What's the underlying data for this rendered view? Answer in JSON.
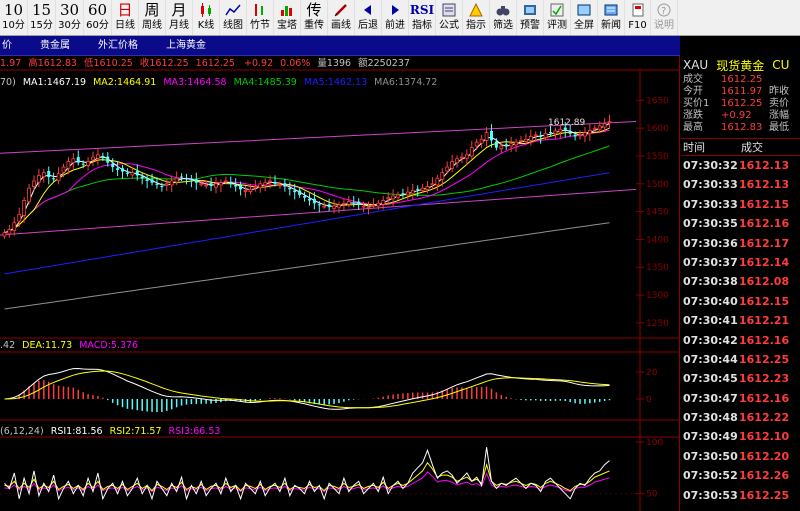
{
  "toolbar": [
    {
      "big": "10",
      "label": "10分"
    },
    {
      "big": "15",
      "label": "15分"
    },
    {
      "big": "30",
      "label": "30分"
    },
    {
      "big": "60",
      "label": "60分"
    },
    {
      "big": "日",
      "label": "日线"
    },
    {
      "big": "周",
      "label": "周线"
    },
    {
      "big": "月",
      "label": "月线"
    },
    {
      "icon": "candlestick-icon",
      "label": "K线"
    },
    {
      "icon": "line-chart-icon",
      "label": "线图"
    },
    {
      "icon": "bamboo-line-icon",
      "label": "竹节"
    },
    {
      "icon": "tower-line-icon",
      "label": "宝塔"
    },
    {
      "big": "传",
      "label": "重传"
    },
    {
      "icon": "pencil-icon",
      "label": "画线"
    },
    {
      "icon": "arrow-left-icon",
      "label": "后退"
    },
    {
      "icon": "arrow-right-icon",
      "label": "前进"
    },
    {
      "big": "RSI",
      "label": "指标"
    },
    {
      "icon": "formula-icon",
      "label": "公式"
    },
    {
      "icon": "signal-icon",
      "label": "指示"
    },
    {
      "icon": "binoculars-icon",
      "label": "筛选"
    },
    {
      "icon": "alert-icon",
      "label": "预警"
    },
    {
      "icon": "evaluate-icon",
      "label": "评测"
    },
    {
      "icon": "fullscreen-icon",
      "label": "全屏"
    },
    {
      "icon": "news-icon",
      "label": "新闻"
    },
    {
      "icon": "f10-icon",
      "label": "F10"
    },
    {
      "icon": "help-icon",
      "label": "说明",
      "disabled": true
    }
  ],
  "tabs": [
    "价",
    "贵金属",
    "外汇价格",
    "上海黄金"
  ],
  "price_header": {
    "open_partial": "1.97",
    "high_label": "高1612.83",
    "low_label": "低1610.25",
    "close_label": "收1612.25",
    "last": "1612.25",
    "change": "+0.92",
    "pct": "0.06%",
    "volume": "量1396",
    "amount": "额2250237"
  },
  "ma_header": {
    "prefix": "70)",
    "ma1": "MA1:1467.19",
    "ma2": "MA2:1464.91",
    "ma3": "MA3:1464.58",
    "ma4": "MA4:1485.39",
    "ma5": "MA5:1462.13",
    "ma6": "MA6:1374.72"
  },
  "macd_header": {
    "prefix": ".42",
    "dea": "DEA:11.73",
    "macd": "MACD:5.376"
  },
  "rsi_header": {
    "prefix": "(6,12,24)",
    "rsi1": "RSI1:81.56",
    "rsi2": "RSI2:71.57",
    "rsi3": "RSI3:66.53"
  },
  "price_axis": [
    "1650",
    "1600",
    "1550",
    "1500",
    "1450",
    "1400",
    "1350",
    "1300",
    "1250"
  ],
  "macd_axis": [
    "20",
    "0"
  ],
  "rsi_axis": [
    "100",
    "50"
  ],
  "last_high_annotation": "1612.89",
  "right_panel": {
    "symbol": "XAU",
    "name": "现货黄金",
    "code_partial": "CU",
    "stats": [
      {
        "k": "成交",
        "v": "1612.25",
        "k2": ""
      },
      {
        "k": "今开",
        "v": "1611.97",
        "k2": "昨收"
      },
      {
        "k": "买价1",
        "v": "1612.25",
        "k2": "卖价"
      },
      {
        "k": "涨跌",
        "v": "+0.92",
        "k2": "涨幅"
      },
      {
        "k": "最高",
        "v": "1612.83",
        "k2": "最低"
      }
    ],
    "col_time": "时间",
    "col_price": "成交",
    "ticks": [
      {
        "t": "07:30:32",
        "p": "1612.13"
      },
      {
        "t": "07:30:33",
        "p": "1612.13"
      },
      {
        "t": "07:30:33",
        "p": "1612.15"
      },
      {
        "t": "07:30:35",
        "p": "1612.16"
      },
      {
        "t": "07:30:36",
        "p": "1612.17"
      },
      {
        "t": "07:30:37",
        "p": "1612.14"
      },
      {
        "t": "07:30:38",
        "p": "1612.08"
      },
      {
        "t": "07:30:40",
        "p": "1612.15"
      },
      {
        "t": "07:30:41",
        "p": "1612.21"
      },
      {
        "t": "07:30:42",
        "p": "1612.16"
      },
      {
        "t": "07:30:44",
        "p": "1612.25"
      },
      {
        "t": "07:30:45",
        "p": "1612.23"
      },
      {
        "t": "07:30:47",
        "p": "1612.16"
      },
      {
        "t": "07:30:48",
        "p": "1612.22"
      },
      {
        "t": "07:30:49",
        "p": "1612.10"
      },
      {
        "t": "07:30:50",
        "p": "1612.20"
      },
      {
        "t": "07:30:52",
        "p": "1612.26"
      },
      {
        "t": "07:30:53",
        "p": "1612.25"
      }
    ]
  },
  "colors": {
    "up": "#ff3c3c",
    "down": "#54ffff",
    "ma1": "#ffffff",
    "ma2": "#ffff00",
    "ma3": "#ff00ff",
    "ma4": "#00cc00",
    "ma5": "#1e1eff",
    "ma6": "#909090",
    "trend": "#cc44cc",
    "grid": "#8b0000"
  },
  "chart_data": {
    "type": "candlestick",
    "ylim": [
      1230,
      1665
    ],
    "close": [
      1412,
      1418,
      1430,
      1445,
      1470,
      1492,
      1505,
      1515,
      1520,
      1512,
      1508,
      1518,
      1530,
      1540,
      1545,
      1538,
      1535,
      1540,
      1548,
      1552,
      1546,
      1538,
      1530,
      1525,
      1522,
      1518,
      1520,
      1515,
      1510,
      1505,
      1502,
      1498,
      1495,
      1500,
      1505,
      1510,
      1512,
      1508,
      1505,
      1502,
      1500,
      1498,
      1496,
      1500,
      1502,
      1505,
      1500,
      1495,
      1490,
      1488,
      1490,
      1495,
      1500,
      1502,
      1505,
      1500,
      1498,
      1495,
      1490,
      1485,
      1480,
      1475,
      1470,
      1465,
      1462,
      1460,
      1458,
      1460,
      1462,
      1465,
      1468,
      1465,
      1462,
      1460,
      1458,
      1462,
      1465,
      1470,
      1475,
      1478,
      1480,
      1482,
      1485,
      1488,
      1490,
      1492,
      1495,
      1500,
      1510,
      1520,
      1530,
      1540,
      1545,
      1548,
      1552,
      1565,
      1575,
      1580,
      1592,
      1578,
      1565,
      1568,
      1570,
      1572,
      1575,
      1578,
      1580,
      1585,
      1588,
      1585,
      1590,
      1592,
      1595,
      1598,
      1596,
      1590,
      1585,
      1588,
      1592,
      1596,
      1600,
      1604,
      1608,
      1612
    ],
    "rsi1": [
      60,
      55,
      70,
      45,
      65,
      50,
      72,
      48,
      60,
      52,
      68,
      45,
      55,
      62,
      50,
      58,
      48,
      65,
      52,
      70,
      45,
      55,
      60,
      50,
      62,
      48,
      55,
      65,
      50,
      58,
      45,
      62,
      55,
      48,
      60,
      52,
      66,
      45,
      58,
      50,
      62,
      48,
      55,
      60,
      50,
      65,
      52,
      58,
      45,
      60,
      55,
      50,
      62,
      48,
      56,
      60,
      52,
      65,
      48,
      58,
      55,
      50,
      62,
      52,
      58,
      45,
      60,
      55,
      50,
      65,
      52,
      58,
      62,
      50,
      55,
      60,
      52,
      66,
      50,
      58,
      62,
      55,
      60,
      70,
      75,
      80,
      92,
      78,
      65,
      70,
      72,
      68,
      60,
      65,
      70,
      62,
      66,
      58,
      95,
      62,
      55,
      60,
      58,
      62,
      65,
      60,
      55,
      60,
      58,
      52,
      62,
      65,
      60,
      55,
      50,
      45,
      55,
      60,
      58,
      65,
      70,
      72,
      78,
      82
    ],
    "rsi2": [
      58,
      57,
      62,
      55,
      60,
      56,
      64,
      55,
      58,
      56,
      62,
      54,
      57,
      59,
      55,
      58,
      54,
      60,
      56,
      62,
      54,
      57,
      58,
      55,
      59,
      54,
      57,
      60,
      55,
      58,
      53,
      59,
      57,
      54,
      58,
      56,
      61,
      54,
      57,
      55,
      59,
      54,
      57,
      58,
      55,
      60,
      56,
      58,
      53,
      58,
      57,
      55,
      59,
      54,
      57,
      58,
      56,
      60,
      54,
      57,
      56,
      55,
      59,
      56,
      57,
      53,
      58,
      57,
      55,
      60,
      56,
      57,
      59,
      55,
      57,
      58,
      56,
      61,
      55,
      58,
      60,
      58,
      60,
      64,
      68,
      72,
      80,
      74,
      66,
      68,
      68,
      66,
      62,
      64,
      66,
      62,
      64,
      60,
      78,
      62,
      58,
      60,
      59,
      61,
      62,
      60,
      58,
      60,
      59,
      56,
      60,
      62,
      60,
      58,
      55,
      53,
      57,
      59,
      59,
      62,
      66,
      68,
      70,
      72
    ]
  }
}
